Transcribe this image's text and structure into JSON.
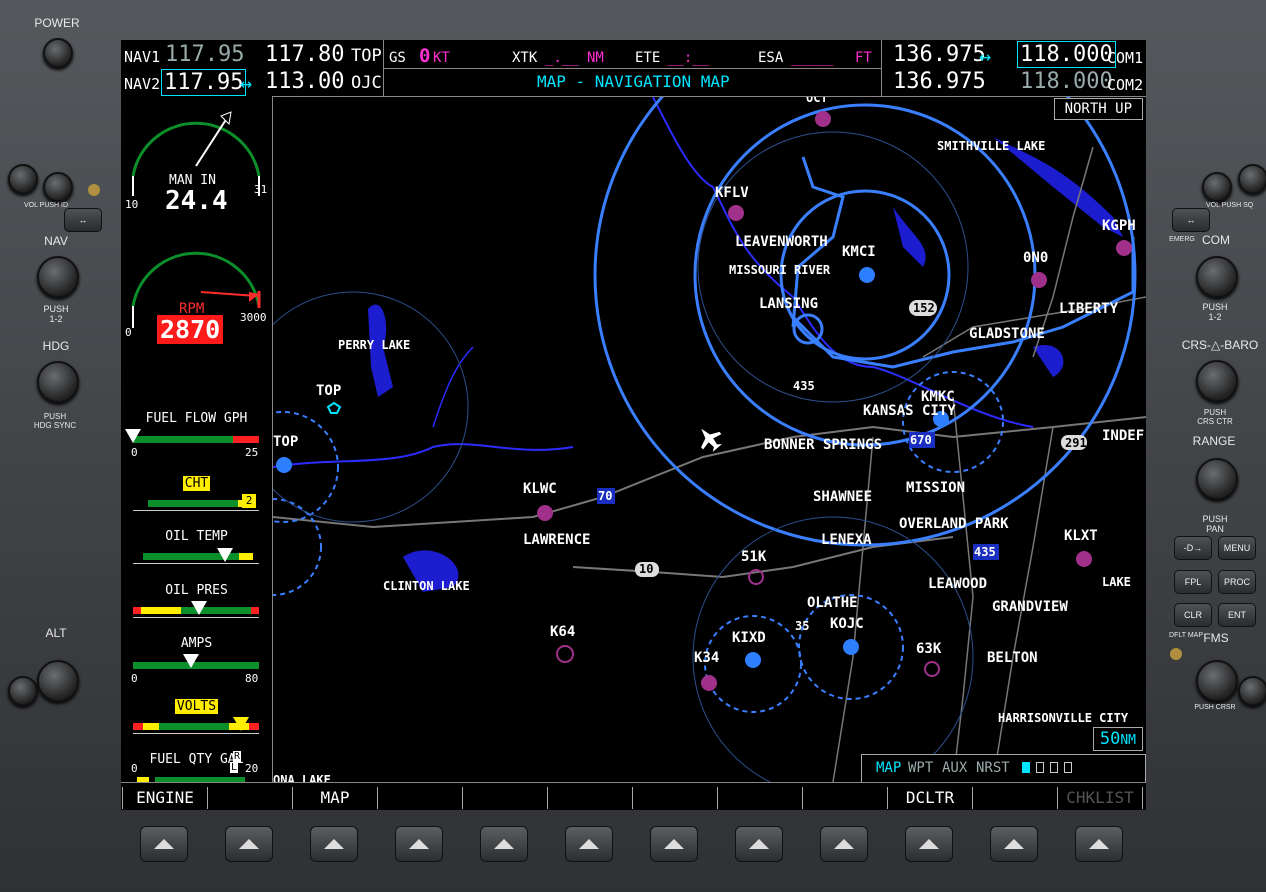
{
  "bezel": {
    "power_label": "POWER",
    "nav_label": "NAV",
    "nav_push": "PUSH\n1-2",
    "hdg_label": "HDG",
    "hdg_push": "PUSH\nHDG SYNC",
    "alt_label": "ALT",
    "vol_label": "VOL PUSH ID",
    "com_label": "COM",
    "com_push": "PUSH\n1-2",
    "com_vol": "VOL PUSH SQ",
    "emerg": "EMERG",
    "crs_baro": "CRS-△-BARO",
    "crs_push": "PUSH\nCRS CTR",
    "range": "RANGE",
    "pan": "PUSH\nPAN",
    "direct": "-D→",
    "menu": "MENU",
    "fpl": "FPL",
    "proc": "PROC",
    "clr": "CLR",
    "ent": "ENT",
    "dflt_map": "DFLT MAP",
    "fms": "FMS",
    "push_crsr": "PUSH CRSR"
  },
  "nav": {
    "nav1_label": "NAV1",
    "nav1_standby": "117.95",
    "nav1_active": "117.80",
    "nav1_ident": "TOP",
    "nav2_label": "NAV2",
    "nav2_standby": "117.95",
    "nav2_arrow": "↔",
    "nav2_active": "113.00",
    "nav2_ident": "OJC"
  },
  "status": {
    "gs_label": "GS",
    "gs_value": "0",
    "gs_unit": "KT",
    "xtk_label": "XTK",
    "xtk_value": "_.__",
    "xtk_unit": "NM",
    "ete_label": "ETE",
    "ete_value": "__:__",
    "esa_label": "ESA",
    "esa_value": "_____",
    "esa_unit": "FT",
    "page_title": "MAP - NAVIGATION MAP"
  },
  "com": {
    "com1_active": "136.975",
    "com1_arrow": "↔",
    "com1_standby": "118.000",
    "com1_label": "COM1",
    "com2_active": "136.975",
    "com2_standby": "118.000",
    "com2_label": "COM2"
  },
  "engine": {
    "man_in_label": "MAN IN",
    "man_in_value": "24.4",
    "man_in_min": "10",
    "man_in_max": "31",
    "rpm_label": "RPM",
    "rpm_value": "2870",
    "rpm_min": "0",
    "rpm_max": "3000",
    "fuel_flow_label": "FUEL FLOW GPH",
    "fuel_flow_min": "0",
    "fuel_flow_max": "25",
    "cht_label": "CHT",
    "cht_cyl": "2",
    "oil_temp_label": "OIL TEMP",
    "oil_pres_label": "OIL PRES",
    "amps_label": "AMPS",
    "amps_min": "0",
    "amps_max": "80",
    "volts_label": "VOLTS",
    "fuel_qty_label": "FUEL QTY GAL",
    "fuel_qty_min": "0",
    "fuel_qty_max": "20",
    "fuel_l": "L",
    "fuel_r": "R"
  },
  "map": {
    "orientation": "NORTH UP",
    "range_value": "50",
    "range_unit": "NM",
    "page_group_active": "MAP",
    "page_group_others": [
      "WPT",
      "AUX",
      "NRST"
    ],
    "labels": {
      "smithville": "SMITHVILLE LAKE",
      "kflv": "KFLV",
      "leavenworth": "LEAVENWORTH",
      "kmci": "KMCI",
      "missouri_river": "MISSOURI RIVER",
      "lansing": "LANSING",
      "ono": "0N0",
      "liberty": "LIBERTY",
      "kgph": "KGPH",
      "gladstone": "GLADSTONE",
      "perry_lake": "PERRY LAKE",
      "top_vor": "TOP",
      "top_apt": "TOP",
      "kmkc": "KMKC",
      "kansas_city": "KANSAS CITY",
      "bonner": "BONNER SPRINGS",
      "inde": "INDEF",
      "klwc": "KLWC",
      "shawnee": "SHAWNEE",
      "mission": "MISSION",
      "lawrence": "LAWRENCE",
      "overland": "OVERLAND PARK",
      "lenexa": "LENEXA",
      "klxt": "KLXT",
      "lake": "LAKE",
      "clinton": "CLINTON LAKE",
      "k51": "51K",
      "leawood": "LEAWOOD",
      "olathe": "OLATHE",
      "grandview": "GRANDVIEW",
      "k64": "K64",
      "kixd": "KIXD",
      "kojc": "KOJC",
      "k63": "63K",
      "k34": "K34",
      "belton": "BELTON",
      "harrisonville": "HARRISONVILLE CITY",
      "oct": "OCT",
      "ona_lake": "ONA LAKE",
      "hwy152": "152",
      "hwy435": "435",
      "hwy670": "670",
      "hwy70": "70",
      "hwy10": "10",
      "hwy435b": "435",
      "hwy35": "35",
      "hwy291": "291",
      "hwy35b": "35"
    }
  },
  "softkeys": [
    "ENGINE",
    "",
    "MAP",
    "",
    "",
    "",
    "",
    "",
    "",
    "DCLTR",
    "",
    "CHKLIST"
  ]
}
